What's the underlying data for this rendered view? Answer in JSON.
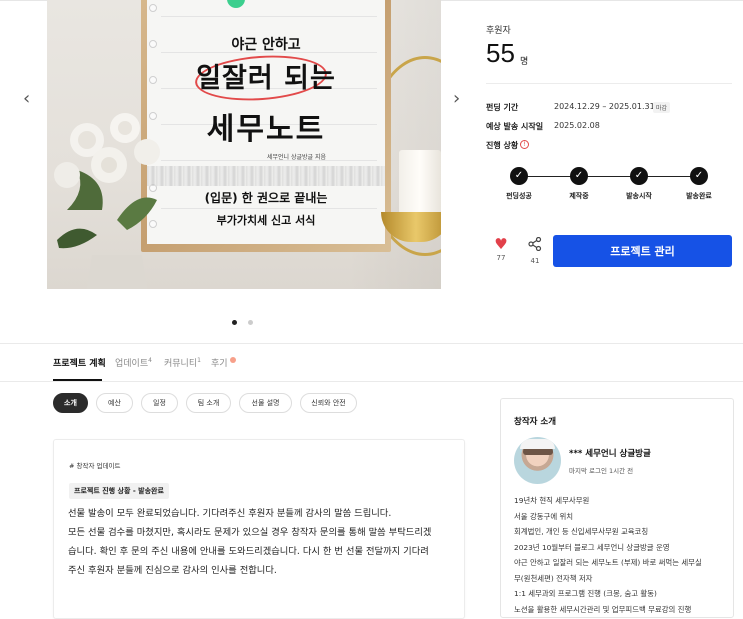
{
  "hero": {
    "poster_subtitle": "야근 안하고",
    "poster_title_line1": "일잘러 되는",
    "poster_title_line2": "세무노트",
    "poster_author": "세무언니 상글방글 지음",
    "poster_bottom1": "(입문) 한 권으로 끝내는",
    "poster_bottom2": "부가가치세 신고 서식",
    "prev_arrow": "‹",
    "next_arrow": "›",
    "slides": 2,
    "active_slide": 1
  },
  "stats": {
    "supporters_label": "후원자",
    "supporters_count": "55",
    "supporters_unit": "명"
  },
  "details": {
    "funding_period_label": "펀딩 기간",
    "funding_period_value": "2024.12.29 – 2025.01.31",
    "funding_period_badge": "마감",
    "ship_start_label": "예상 발송 시작일",
    "ship_start_value": "2025.02.08",
    "progress_label": "진행 상황",
    "info_icon": "!"
  },
  "progress": {
    "steps": [
      "펀딩성공",
      "제작중",
      "발송시작",
      "발송완료"
    ],
    "check_glyph": "✓"
  },
  "actions": {
    "like_count": "77",
    "share_count": "41",
    "manage_label": "프로젝트 관리",
    "heart_glyph": "♥"
  },
  "tabs": {
    "plan": "프로젝트 계획",
    "update": "업데이트",
    "update_count": "4",
    "community": "커뮤니티",
    "community_count": "1",
    "review": "후기",
    "new_mark": "N"
  },
  "chips": [
    "소개",
    "예산",
    "일정",
    "팀 소개",
    "선물 설명",
    "신뢰와 안전"
  ],
  "update_card": {
    "tag": "# 창작자 업데이트",
    "pill": "프로젝트 진행 상황 - 발송완료",
    "lines": [
      "선물 발송이 모두 완료되었습니다. 기다려주신 후원자 분들께 감사의 말씀 드립니다.",
      "모든 선물 검수를 마쳤지만, 혹시라도 문제가 있으실 경우 창작자 문의를 통해 말씀 부탁드리겠",
      "습니다. 확인 후 문의 주신 내용에 안내를 도와드리겠습니다. 다시 한 번 선물 전달까지 기다려",
      "주신 후원자 분들께 진심으로 감사의 인사를 전합니다."
    ]
  },
  "creator": {
    "title": "창작자 소개",
    "name": "*** 세무언니 상글방글",
    "last_login": "마지막 로그인 1시간 전",
    "bio": [
      "19년차 현직 세무사무원",
      "서울 강동구에 위치",
      "회계법인, 개인 등 신입세무사무원 교육코칭",
      "2023년 10월부터 블로그 세무언니 상글방글 운영",
      "야근 안하고 일잘러 되는 세무노트 (부제) 바로 써먹는 세무실",
      "무(원천세편) 전자책 저자",
      "1:1 세무과외 프로그램 진행 (크몽, 숨고 활동)",
      "노션을 활용한 세무시간관리 및 업무피드백 무료강의 진행"
    ]
  }
}
